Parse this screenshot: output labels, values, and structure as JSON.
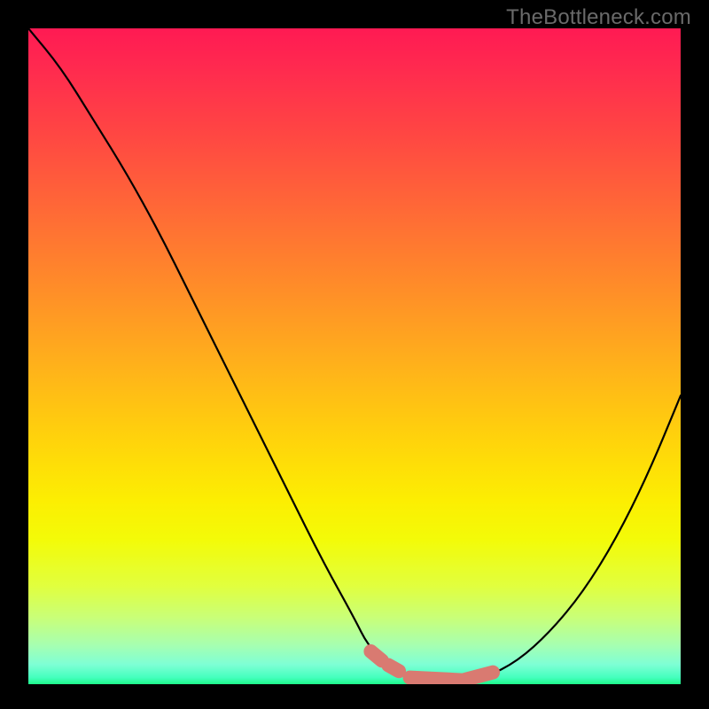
{
  "watermark": "TheBottleneck.com",
  "chart_data": {
    "type": "line",
    "title": "",
    "xlabel": "",
    "ylabel": "",
    "xlim": [
      0,
      100
    ],
    "ylim": [
      0,
      100
    ],
    "series": [
      {
        "name": "bottleneck-curve",
        "x": [
          0,
          5,
          10,
          15,
          20,
          25,
          30,
          35,
          40,
          45,
          50,
          52,
          55,
          58,
          60,
          63,
          66,
          70,
          75,
          80,
          85,
          90,
          95,
          100
        ],
        "values": [
          100,
          94,
          86,
          78,
          69,
          59,
          49,
          39,
          29,
          19,
          10,
          6,
          3,
          1.2,
          0.6,
          0.4,
          0.5,
          1,
          3.5,
          8,
          14,
          22,
          32,
          44
        ]
      }
    ],
    "markers": {
      "name": "highlight-pills",
      "color": "#d97a71",
      "segments": [
        {
          "x": [
            52.5,
            54.2
          ],
          "values": [
            5.0,
            3.6
          ]
        },
        {
          "x": [
            55.2,
            56.8
          ],
          "values": [
            2.9,
            2.0
          ]
        },
        {
          "x": [
            58.5,
            66.5
          ],
          "values": [
            1.0,
            0.6
          ]
        },
        {
          "x": [
            67.0,
            71.2
          ],
          "values": [
            0.7,
            1.8
          ]
        }
      ]
    },
    "background_gradient": {
      "top": "#ff1a53",
      "upper_mid": "#ff8e28",
      "mid": "#ffd40b",
      "lower_mid": "#e1ff3e",
      "bottom": "#1ef98a"
    }
  }
}
